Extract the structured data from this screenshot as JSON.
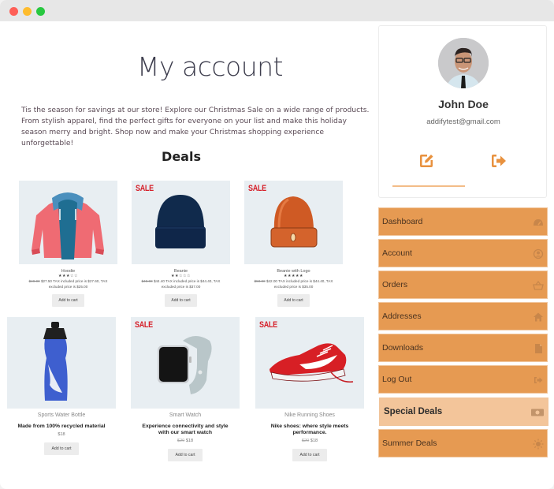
{
  "window": {
    "controls": [
      "close",
      "minimize",
      "maximize"
    ]
  },
  "main": {
    "title": "My account",
    "intro": "Tis the season for savings at our store! Explore our Christmas Sale on a wide range of products. From stylish apparel, find the perfect gifts for everyone on your list and make this holiday season merry and bright. Shop now and make your Christmas shopping experience unforgettable!",
    "deals_title": "Deals",
    "products_row1": [
      {
        "name": "Hoodie",
        "image": "hoodie-image",
        "sale": false,
        "rating": "★★★☆☆",
        "old_price": "$49.00",
        "price_text": "$27.50 TAX included price is $27.60, TAX excluded price is $25.00",
        "button": "Add to cart"
      },
      {
        "name": "Beanie",
        "image": "beanie-image",
        "sale": true,
        "sale_label": "SALE",
        "rating": "★★☆☆☆",
        "old_price": "$48.00",
        "price_text": "$44.40 TAX included price is $44.40, TAX excluded price is $37.00",
        "button": "Add to cart"
      },
      {
        "name": "Beanie with Logo",
        "image": "beanie-logo-image",
        "sale": true,
        "sale_label": "SALE",
        "rating": "★★★★★",
        "old_price": "$50.00",
        "price_text": "$42.00 TAX included price is $44.40, TAX excluded price is $35.00",
        "button": "Add to cart"
      }
    ],
    "products_row2": [
      {
        "name": "Sports Water Bottle",
        "image": "water-bottle-image",
        "sale": false,
        "description": "Made from 100% recycled material",
        "old_price": "",
        "price": "$18",
        "button": "Add to cart"
      },
      {
        "name": "Smart Watch",
        "image": "smart-watch-image",
        "sale": true,
        "sale_label": "SALE",
        "description": "Experience connectivity and style with our smart watch",
        "old_price": "$20",
        "price": "$18",
        "button": "Add to cart"
      },
      {
        "name": "Nike Running Shoes",
        "image": "running-shoes-image",
        "sale": true,
        "sale_label": "SALE",
        "description": "Nike shoes: where style meets performance.",
        "old_price": "$20",
        "price": "$18",
        "button": "Add to cart"
      }
    ]
  },
  "profile": {
    "name": "John Doe",
    "email": "addifytest@gmail.com",
    "edit_icon": "edit-icon",
    "logout_icon": "logout-icon"
  },
  "nav": {
    "items": [
      {
        "label": "Dashboard",
        "icon": "dashboard-icon",
        "active": false
      },
      {
        "label": "Account",
        "icon": "user-icon",
        "active": false
      },
      {
        "label": "Orders",
        "icon": "basket-icon",
        "active": false
      },
      {
        "label": "Addresses",
        "icon": "home-icon",
        "active": false
      },
      {
        "label": "Downloads",
        "icon": "file-icon",
        "active": false
      },
      {
        "label": "Log Out",
        "icon": "logout-icon",
        "active": false
      },
      {
        "label": "Special Deals",
        "icon": "money-icon",
        "active": true
      },
      {
        "label": "Summer Deals",
        "icon": "sun-icon",
        "active": false
      }
    ]
  },
  "colors": {
    "accent": "#e69a52",
    "accent_active": "#f3c59a",
    "sale_red": "#d6202a",
    "icon_orange": "#e8913e"
  }
}
